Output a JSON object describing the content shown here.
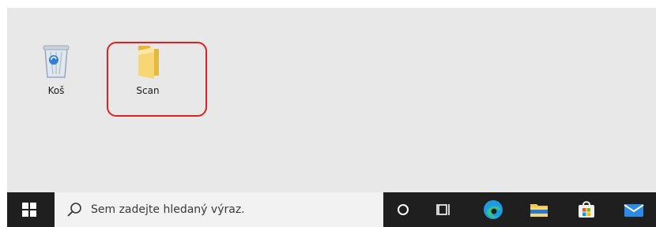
{
  "desktop": {
    "icons": [
      {
        "label": "Koš",
        "icon": "recycle-bin-icon"
      },
      {
        "label": "Scan",
        "icon": "folder-icon"
      }
    ],
    "highlight_color": "#e02020"
  },
  "taskbar": {
    "start_icon": "windows-logo-icon",
    "search_placeholder": "Sem zadejte hledaný výraz.",
    "buttons": [
      {
        "icon": "cortana-icon"
      },
      {
        "icon": "task-view-icon"
      },
      {
        "icon": "edge-icon"
      },
      {
        "icon": "file-explorer-icon"
      },
      {
        "icon": "microsoft-store-icon"
      },
      {
        "icon": "mail-icon"
      }
    ]
  }
}
